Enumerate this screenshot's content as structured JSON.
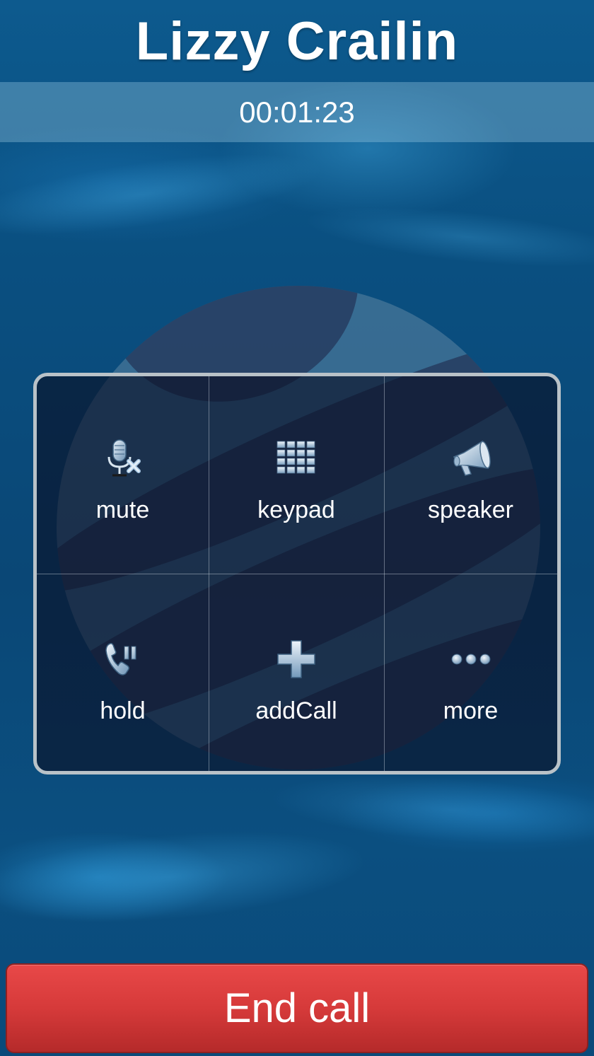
{
  "call": {
    "contact_name": "Lizzy Crailin",
    "duration": "00:01:23"
  },
  "controls": [
    {
      "label": "mute",
      "icon": "mute-microphone-icon"
    },
    {
      "label": "keypad",
      "icon": "keypad-icon"
    },
    {
      "label": "speaker",
      "icon": "speaker-icon"
    },
    {
      "label": "hold",
      "icon": "hold-icon"
    },
    {
      "label": "addCall",
      "icon": "add-call-icon"
    },
    {
      "label": "more",
      "icon": "more-icon"
    }
  ],
  "end_call": {
    "label": "End call"
  },
  "colors": {
    "background": "#0a4f80",
    "end_call": "#d63a3a",
    "panel_border": "#b9c2c8",
    "text": "#ffffff"
  }
}
